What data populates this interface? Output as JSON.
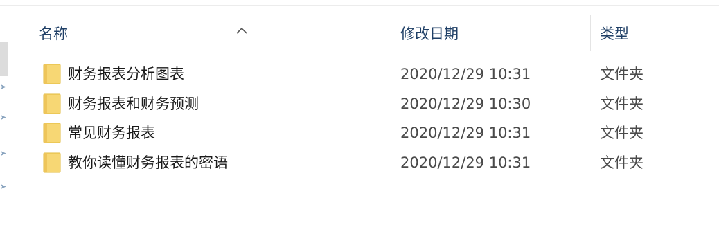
{
  "header": {
    "sort_indicator_icon": "chevron-up-icon",
    "columns": {
      "name": "名称",
      "date_modified": "修改日期",
      "type": "类型"
    }
  },
  "rows": [
    {
      "icon": "folder-icon",
      "name": "财务报表分析图表",
      "date": "2020/12/29 10:31",
      "type": "文件夹"
    },
    {
      "icon": "folder-icon",
      "name": "财务报表和财务预测",
      "date": "2020/12/29 10:30",
      "type": "文件夹"
    },
    {
      "icon": "folder-icon",
      "name": "常见财务报表",
      "date": "2020/12/29 10:31",
      "type": "文件夹"
    },
    {
      "icon": "folder-icon",
      "name": "教你读懂财务报表的密语",
      "date": "2020/12/29 10:31",
      "type": "文件夹"
    }
  ],
  "colors": {
    "header_text": "#1f3f66",
    "folder_fill": "#f7d774",
    "folder_edge": "#e0b93a"
  }
}
